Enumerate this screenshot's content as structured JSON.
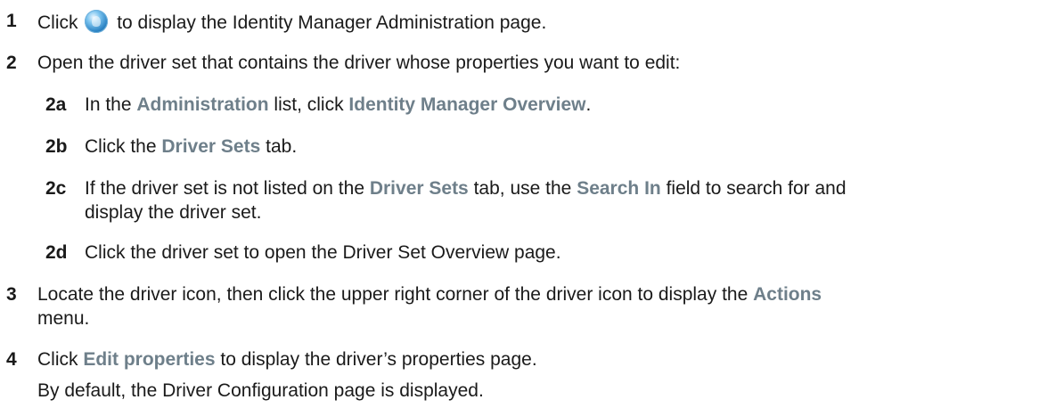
{
  "steps": [
    {
      "num": "1",
      "t1": "Click",
      "t2": "to display the Identity Manager Administration page.",
      "icon": "identity-manager-globe-icon"
    },
    {
      "num": "2",
      "t1": "Open the driver set that contains the driver whose properties you want to edit:"
    },
    {
      "num": "2a",
      "t1": "In the",
      "u1": "Administration",
      "t2": "list, click",
      "u2": "Identity Manager Overview",
      "t3": "."
    },
    {
      "num": "2b",
      "t1": "Click the",
      "u1": "Driver Sets",
      "t2": "tab."
    },
    {
      "num": "2c",
      "t1": "If the driver set is not listed on the",
      "u1": "Driver Sets",
      "t2": "tab, use the",
      "u2": "Search In",
      "t3": "field to search for and",
      "line2": "display the driver set."
    },
    {
      "num": "2d",
      "t1": "Click the driver set to open the Driver Set Overview page."
    },
    {
      "num": "3",
      "t1": "Locate the driver icon, then click the upper right corner of the driver icon to display the",
      "u1": "Actions",
      "line2": "menu."
    },
    {
      "num": "4",
      "t1": "Click",
      "u1": "Edit properties",
      "t2": "to display the driver’s properties page."
    }
  ],
  "note": "By default, the Driver Configuration page is displayed.",
  "colors": {
    "ui_term": "#6e7f8a",
    "text": "#1a1a1a"
  }
}
